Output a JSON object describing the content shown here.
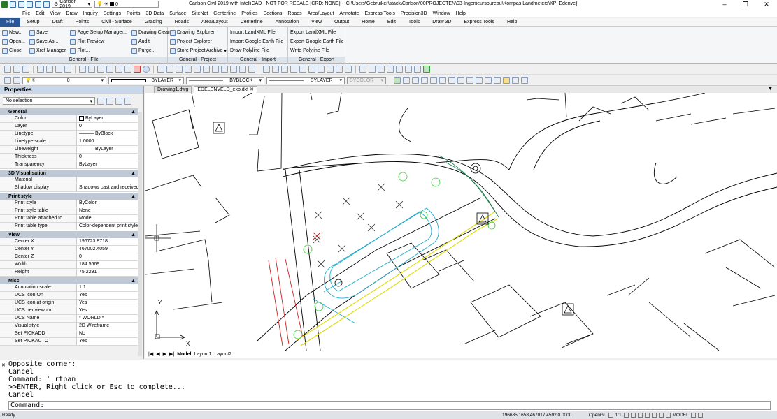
{
  "title_bar": {
    "title": "Carlson Civil 2019 with IntelliCAD - NOT FOR RESALE [CRD: NONE] - [C:\\Users\\Gebruiker\\stack\\Carlson\\00PROJECTEN\\03-Ingenieursbureau\\Kompas Landmeters\\KP_Edenve]",
    "workspace": "Carlson 2019",
    "layer": "0",
    "minimize": "–",
    "maximize": "❐",
    "close": "✕"
  },
  "menu": [
    "File",
    "Edit",
    "View",
    "Draw",
    "Inquiry",
    "Settings",
    "Points",
    "3D Data",
    "Surface",
    "SiteNet",
    "Centerline",
    "Profiles",
    "Sections",
    "Roads",
    "Area/Layout",
    "Annotate",
    "Express Tools",
    "Precision3D",
    "Window",
    "Help"
  ],
  "ribbon_tabs": [
    "File",
    "Setup",
    "Draft",
    "Points",
    "Civil - Surface",
    "Grading",
    "Roads",
    "Area/Layout",
    "Centerline",
    "Annotation",
    "View",
    "Output",
    "Home",
    "Edit",
    "Tools",
    "Draw 3D",
    "Express Tools",
    "Help"
  ],
  "ribbon_active_tab": "File",
  "ribbon": {
    "file_panel": {
      "title": "General - File",
      "col1": [
        "New...",
        "Open...",
        "Close"
      ],
      "col2": [
        "Save",
        "Save As...",
        "Xref Manager"
      ],
      "col3": [
        "Page Setup Manager...",
        "Plot Preview",
        "Plot..."
      ],
      "col4": [
        "Drawing Cleanup",
        "Audit",
        "Purge..."
      ]
    },
    "project_panel": {
      "title": "General - Project",
      "items": [
        "Drawing Explorer",
        "Project Explorer",
        "Store Project Archive"
      ]
    },
    "import_panel": {
      "title": "General - Import",
      "items": [
        "Import LandXML File",
        "Import Google Earth File",
        "Draw Polyline File"
      ]
    },
    "export_panel": {
      "title": "General - Export",
      "items": [
        "Export LandXML File",
        "Export Google Earth File",
        "Write Polyline File"
      ]
    }
  },
  "layer_toolbar": {
    "layer_value": "0",
    "color": "BYLAYER",
    "linetype": "BYBLOCK",
    "lineweight": "BYLAYER",
    "plotstyle": "BYCOLOR"
  },
  "properties": {
    "header": "Properties",
    "selection": "No selection",
    "sections": [
      {
        "name": "General",
        "rows": [
          [
            "Color",
            "ByLayer"
          ],
          [
            "Layer",
            "0"
          ],
          [
            "Linetype",
            "——— ByBlock"
          ],
          [
            "Linetype scale",
            "1.0000"
          ],
          [
            "Lineweight",
            "——— ByLayer"
          ],
          [
            "Thickness",
            "0"
          ],
          [
            "Transparency",
            "ByLayer"
          ]
        ]
      },
      {
        "name": "3D Visualisation",
        "rows": [
          [
            "Material",
            ""
          ],
          [
            "Shadow display",
            "Shadows cast and received"
          ]
        ]
      },
      {
        "name": "Print style",
        "rows": [
          [
            "Print style",
            "ByColor"
          ],
          [
            "Print style table",
            "None"
          ],
          [
            "Print table attached to",
            "Model"
          ],
          [
            "Print table type",
            "Color-dependent print style"
          ]
        ]
      },
      {
        "name": "View",
        "rows": [
          [
            "Center X",
            "196723.8718"
          ],
          [
            "Center Y",
            "467002.4059"
          ],
          [
            "Center Z",
            "0"
          ],
          [
            "Width",
            "184.5669"
          ],
          [
            "Height",
            "75.2291"
          ]
        ]
      },
      {
        "name": "Misc",
        "rows": [
          [
            "Annotation scale",
            "1:1"
          ],
          [
            "UCS icon On",
            "Yes"
          ],
          [
            "UCS icon at origin",
            "Yes"
          ],
          [
            "UCS per viewport",
            "Yes"
          ],
          [
            "UCS Name",
            "* WORLD *"
          ],
          [
            "Visual style",
            "2D Wireframe"
          ],
          [
            "Set PICKADD",
            "No"
          ],
          [
            "Set PICKAUTO",
            "Yes"
          ]
        ]
      }
    ]
  },
  "doc_tabs": [
    "Drawing1.dwg",
    "EDELENVELD_exp.dxf"
  ],
  "active_doc": "EDELENVELD_exp.dxf",
  "layout_tabs": [
    "Model",
    "Layout1",
    "Layout2"
  ],
  "ucs": {
    "x": "X",
    "y": "Y"
  },
  "command_history": [
    "Opposite corner:",
    "Cancel",
    "Command: '_rtpan",
    ">>ENTER, Right click or Esc to complete...",
    "Cancel"
  ],
  "command_prompt": "Command:",
  "status": {
    "left": "Ready",
    "coords": "196685.1658,467017.4592,0.0000",
    "render": "OpenGL",
    "scale": "1:1",
    "model": "MODEL"
  },
  "colors": {
    "ribbon_active": "#2b5797",
    "section_header": "#bfc9d6",
    "drawing_cyan": "#22aacc",
    "drawing_green": "#33cc33",
    "drawing_red": "#cc2222",
    "drawing_yellow": "#dddd00"
  }
}
